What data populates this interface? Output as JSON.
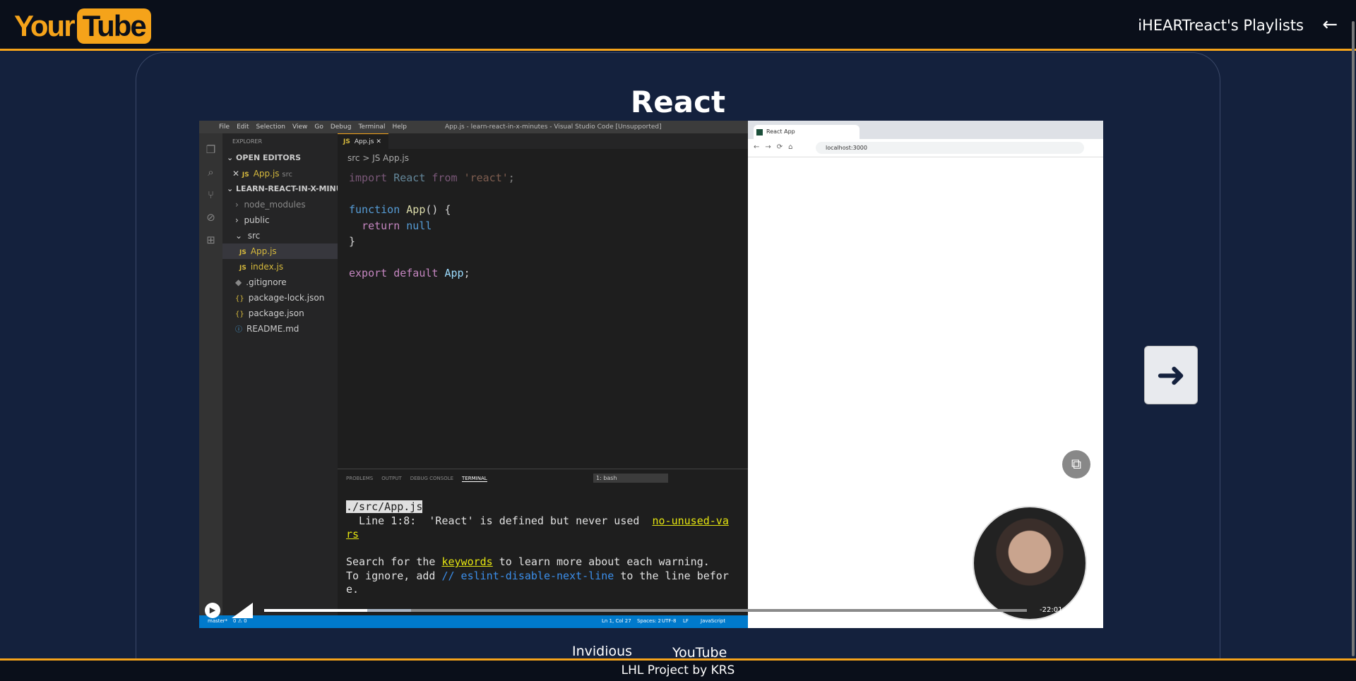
{
  "header": {
    "logo_your": "Your",
    "logo_tube": "Tube",
    "playlists_label": "iHEARTreact's Playlists",
    "back_icon": "arrow-left-icon"
  },
  "main": {
    "title": "React"
  },
  "video": {
    "vscode": {
      "menu": [
        "File",
        "Edit",
        "Selection",
        "View",
        "Go",
        "Debug",
        "Terminal",
        "Help"
      ],
      "window_title": "App.js - learn-react-in-x-minutes - Visual Studio Code [Unsupported]",
      "explorer_label": "EXPLORER",
      "open_editors": "OPEN EDITORS",
      "open_file": "App.js",
      "open_file_dir": "src",
      "project": "LEARN-REACT-IN-X-MINUTES",
      "tree": [
        "node_modules",
        "public",
        "src",
        "App.js",
        "index.js",
        ".gitignore",
        "package-lock.json",
        "package.json",
        "README.md"
      ],
      "tab": "App.js",
      "breadcrumb": "src > JS App.js",
      "panel_tabs": [
        "PROBLEMS",
        "OUTPUT",
        "DEBUG CONSOLE",
        "TERMINAL"
      ],
      "shell": "1: bash",
      "terminal": {
        "file": "./src/App.js",
        "line1_pre": "  Line 1:8:  'React' is defined but never used  ",
        "line1_rule": "no-unused-va",
        "line1_rule_cont": "rs",
        "line2_pre": "Search for the ",
        "line2_kw": "keywords",
        "line2_post": " to learn more about each warning.",
        "line3_pre": "To ignore, add ",
        "line3_cmt": "// eslint-disable-next-line",
        "line3_post": " to the line befor",
        "line3_cont": "e."
      },
      "status": {
        "branch": "master*",
        "problems": "0 ⚠ 0",
        "position": "Ln 1, Col 27",
        "spaces": "Spaces: 2",
        "encoding": "UTF-8",
        "eol": "LF",
        "language": "JavaScript"
      }
    },
    "browser": {
      "tab_title": "React App",
      "url": "localhost:3000"
    },
    "controls": {
      "time_remaining": "-22:01",
      "progress_fraction": 0.135,
      "buffer_fraction": 0.193
    }
  },
  "source_links": {
    "invidious": "Invidious",
    "youtube": "YouTube"
  },
  "footer": {
    "text": "LHL Project by KRS"
  }
}
